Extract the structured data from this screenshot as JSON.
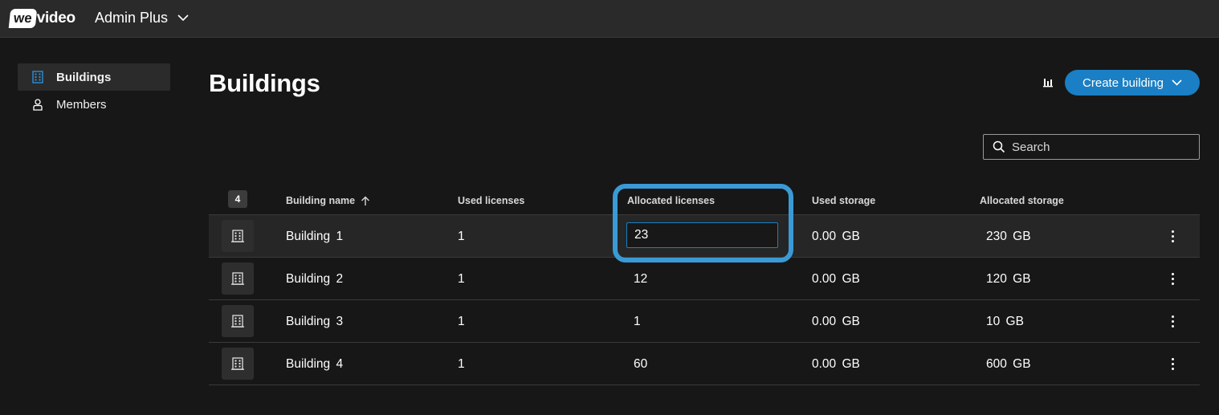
{
  "header": {
    "logo_we": "we",
    "logo_video": "video",
    "app_name": "Admin Plus"
  },
  "sidebar": {
    "items": [
      {
        "label": "Buildings",
        "icon": "building-icon",
        "active": true
      },
      {
        "label": "Members",
        "icon": "person-icon",
        "active": false
      }
    ]
  },
  "main": {
    "title": "Buildings",
    "create_button_label": "Create building",
    "search_placeholder": "Search"
  },
  "table": {
    "count": "4",
    "columns": [
      "Building name",
      "Used licenses",
      "Allocated licenses",
      "Used storage",
      "Allocated storage"
    ],
    "sort": {
      "column": "Building name",
      "direction": "ascending"
    },
    "rows": [
      {
        "name": "Building 1",
        "used_licenses": "1",
        "allocated_licenses": "23",
        "used_storage": "0.00 GB",
        "allocated_storage": "230 GB"
      },
      {
        "name": "Building 2",
        "used_licenses": "1",
        "allocated_licenses": "12",
        "used_storage": "0.00 GB",
        "allocated_storage": "120 GB"
      },
      {
        "name": "Building 3",
        "used_licenses": "1",
        "allocated_licenses": "1",
        "used_storage": "0.00 GB",
        "allocated_storage": "10 GB"
      },
      {
        "name": "Building 4",
        "used_licenses": "1",
        "allocated_licenses": "60",
        "used_storage": "0.00 GB",
        "allocated_storage": "600 GB"
      }
    ],
    "editing": {
      "row": 0,
      "field": "allocated_licenses"
    }
  },
  "colors": {
    "accent": "#1a7fc4",
    "highlight": "#3a9ad6",
    "background": "#171717",
    "topbar": "#2a2a2a"
  }
}
